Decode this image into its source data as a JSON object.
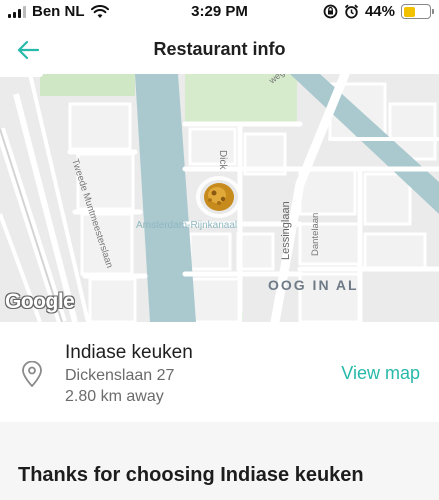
{
  "status_bar": {
    "carrier": "Ben NL",
    "time": "3:29 PM",
    "battery_percent": "44%",
    "battery_level": 0.44
  },
  "header": {
    "title": "Restaurant info",
    "back_icon": "arrow-left-icon",
    "accent_color": "#27b9a9"
  },
  "map": {
    "streets": [
      "Tweede Muntmeesterslaan",
      "Lessinglaan",
      "Dantelaan",
      "Dick",
      "Amsterdam-Rijnkanaal",
      "OOG IN AL",
      "weg"
    ],
    "attribution": "Google"
  },
  "restaurant": {
    "name": "Indiase keuken",
    "address": "Dickenslaan 27",
    "distance": "2.80 km away",
    "view_map_label": "View map"
  },
  "footer": {
    "thanks": "Thanks for choosing Indiase keuken"
  }
}
